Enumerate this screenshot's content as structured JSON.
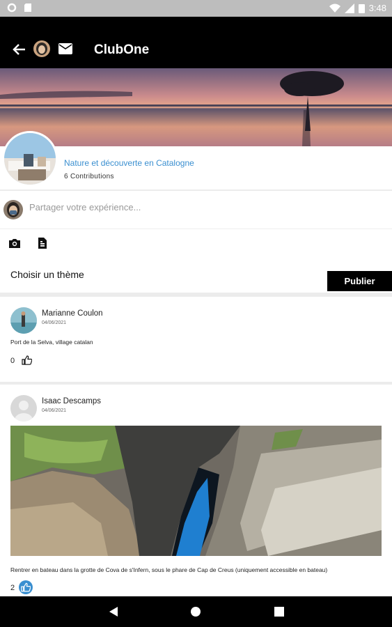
{
  "statusbar": {
    "time": "3:48"
  },
  "appbar": {
    "title": "ClubOne"
  },
  "group": {
    "name": "Nature et découverte en Catalogne",
    "contributions": "6 Contributions"
  },
  "compose": {
    "placeholder": "Partager votre expérience...",
    "theme_label": "Choisir un thème",
    "publish_label": "Publier"
  },
  "posts": [
    {
      "author": "Marianne Coulon",
      "date": "04/06/2021",
      "text": "Port de la Selva, village catalan",
      "likes": "0"
    },
    {
      "author": "Isaac Descamps",
      "date": "04/06/2021",
      "text": "Rentrer en bateau dans la grotte de Cova de s'Infern, sous le phare de Cap de Creus (uniquement accessible en bateau)",
      "likes": "2"
    }
  ],
  "colors": {
    "accent": "#3a8fd0",
    "appbar": "#000000",
    "like_active": "#3a8fd0"
  },
  "icons": [
    "back-arrow-icon",
    "mail-icon",
    "camera-icon",
    "document-icon",
    "thumb-up-icon",
    "back-triangle-icon",
    "home-circle-icon",
    "recents-square-icon"
  ]
}
